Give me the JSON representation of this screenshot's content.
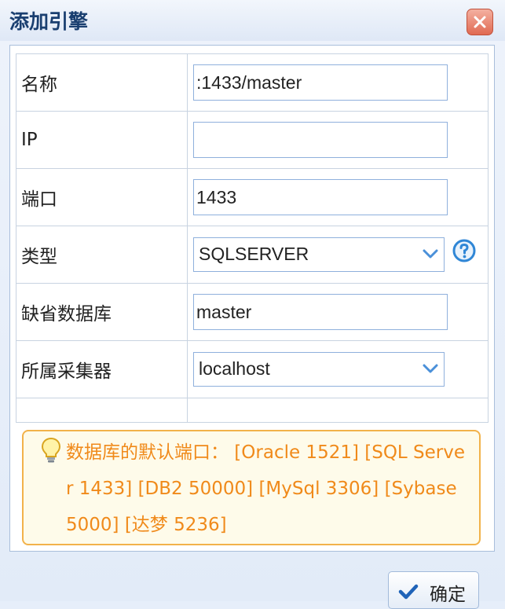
{
  "dialog": {
    "title": "添加引擎",
    "close_icon": "close-icon"
  },
  "form": {
    "rows": [
      {
        "label": "名称",
        "value": ":1433/master"
      },
      {
        "label": "IP",
        "value": ""
      },
      {
        "label": "端口",
        "value": "1433"
      },
      {
        "label": "类型",
        "value": "SQLSERVER"
      },
      {
        "label": "缺省数据库",
        "value": "master"
      },
      {
        "label": "所属采集器",
        "value": "localhost"
      }
    ]
  },
  "hint": {
    "text": "数据库的默认端口： [Oracle 1521] [SQL Server 1433] [DB2 50000] [MySql 3306] [Sybase 5000] [达梦 5236]",
    "color": "#f08a1a",
    "icon": "lightbulb-icon"
  },
  "footer": {
    "confirm_label": "确定",
    "confirm_icon": "checkmark-icon"
  }
}
